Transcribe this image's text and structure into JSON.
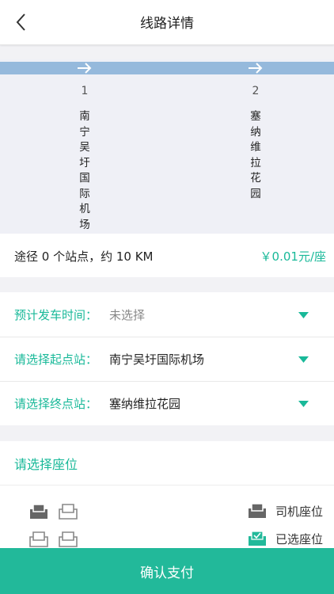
{
  "header": {
    "title": "线路详情",
    "back_icon": "chevron-left-icon"
  },
  "route": {
    "stops": [
      {
        "number": "1",
        "name": "南宁吴圩国际机场"
      },
      {
        "number": "2",
        "name": "塞纳维拉花园"
      }
    ],
    "bar_color": "#95b9dc"
  },
  "trip_info": {
    "summary": "途径 0 个站点，约 10 KM",
    "price": "￥0.01元/座"
  },
  "form": {
    "departure_time": {
      "label": "预计发车时间：",
      "value": "未选择"
    },
    "start_station": {
      "label": "请选择起点站：",
      "value": "南宁吴圩国际机场"
    },
    "end_station": {
      "label": "请选择终点站：",
      "value": "塞纳维拉花园"
    }
  },
  "seats": {
    "title": "请选择座位",
    "legend": {
      "driver_label": "司机座位",
      "selected_label": "已选座位"
    }
  },
  "confirm_button": {
    "label": "确认支付"
  },
  "colors": {
    "accent": "#19b999",
    "button": "#22b99a",
    "driver_seat": "#666666",
    "empty_seat": "#888888"
  }
}
